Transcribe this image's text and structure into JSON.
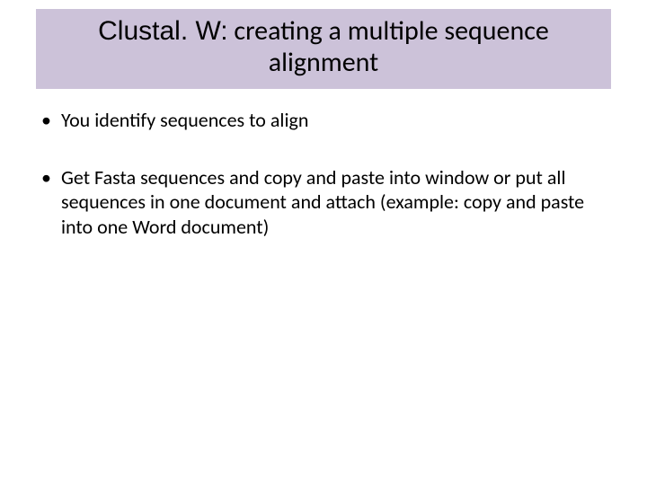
{
  "title": {
    "prefix": "Clustal. W:",
    "rest": " creating a multiple sequence alignment"
  },
  "bullets": [
    "You identify sequences to align",
    "Get Fasta sequences and copy and paste into window or  put all sequences in one document and attach (example: copy and paste into one Word document)"
  ]
}
